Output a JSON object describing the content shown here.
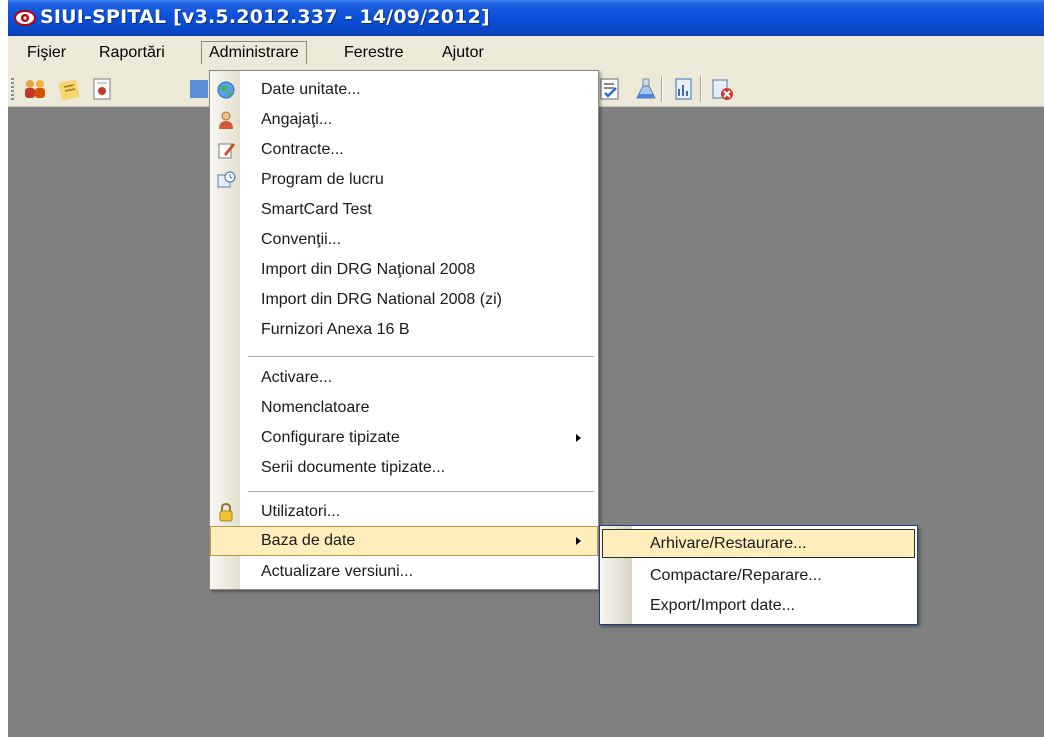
{
  "window": {
    "title": "SIUI-SPITAL [v3.5.2012.337 - 14/09/2012]"
  },
  "menubar": {
    "items": [
      {
        "label": "Fişier"
      },
      {
        "label": "Raportări"
      },
      {
        "label": "Administrare"
      },
      {
        "label": "Ferestre"
      },
      {
        "label": "Ajutor"
      }
    ]
  },
  "dropdown": {
    "items": [
      {
        "label": "Date unitate...",
        "icon": "globe-icon"
      },
      {
        "label": "Angajaţi...",
        "icon": "user-icon"
      },
      {
        "label": "Contracte...",
        "icon": "document-edit-icon"
      },
      {
        "label": "Program de lucru",
        "icon": "schedule-icon"
      },
      {
        "label": "SmartCard Test"
      },
      {
        "label": "Convenţii..."
      },
      {
        "label": "Import din DRG Naţional 2008"
      },
      {
        "label": "Import din DRG National 2008 (zi)"
      },
      {
        "label": "Furnizori Anexa 16 B"
      },
      {
        "label": "Activare..."
      },
      {
        "label": "Nomenclatoare"
      },
      {
        "label": "Configurare tipizate",
        "submenu": true
      },
      {
        "label": "Serii documente tipizate..."
      },
      {
        "label": "Utilizatori...",
        "icon": "lock-icon"
      },
      {
        "label": "Baza de date",
        "submenu": true,
        "highlighted": true
      },
      {
        "label": "Actualizare versiuni..."
      }
    ]
  },
  "submenu": {
    "items": [
      {
        "label": "Arhivare/Restaurare...",
        "highlighted": true
      },
      {
        "label": "Compactare/Reparare..."
      },
      {
        "label": "Export/Import date..."
      }
    ]
  },
  "colors": {
    "titlebar": "#0a4fd9",
    "menubar": "#ece9d8",
    "workspace": "#808080",
    "highlight": "#ffeebb"
  }
}
